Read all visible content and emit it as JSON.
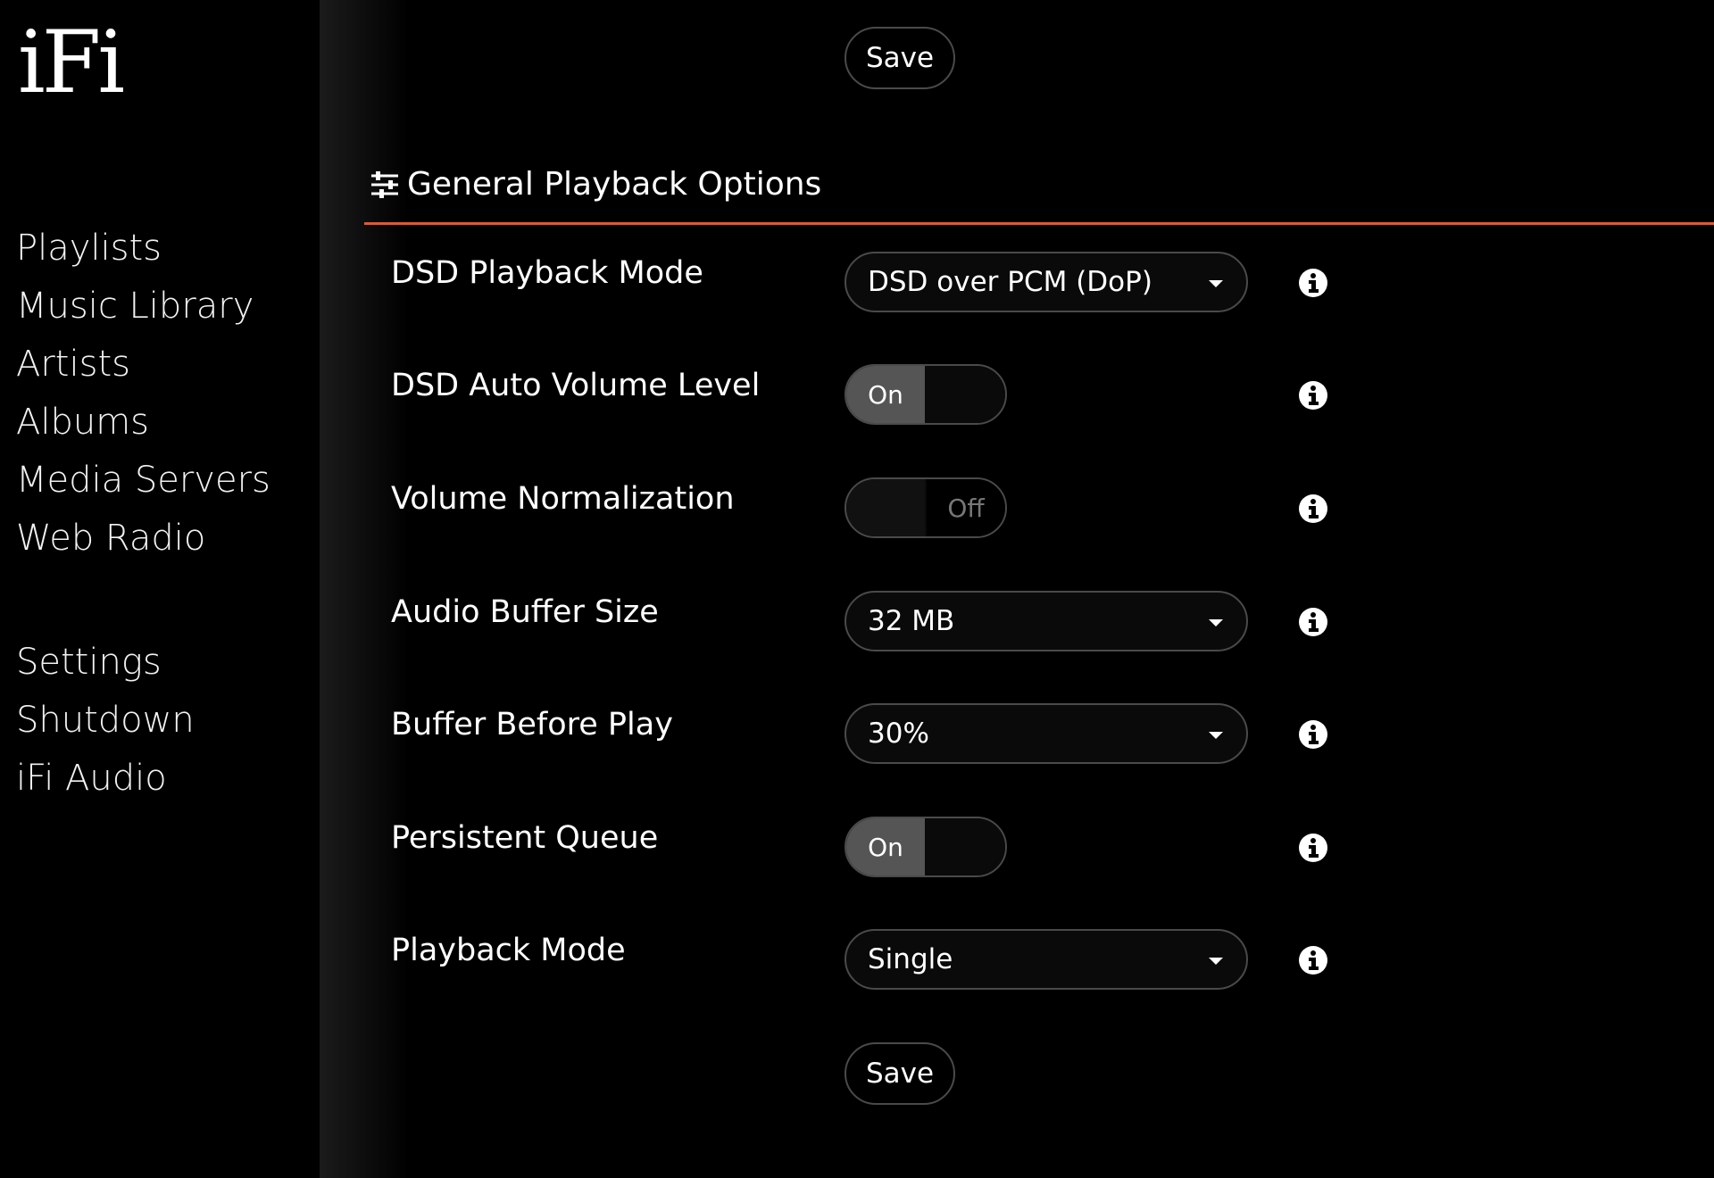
{
  "sidebar": {
    "logo_text": "iFi",
    "primary_items": [
      {
        "label": "Playlists"
      },
      {
        "label": "Music Library"
      },
      {
        "label": "Artists"
      },
      {
        "label": "Albums"
      },
      {
        "label": "Media Servers"
      },
      {
        "label": "Web Radio"
      }
    ],
    "secondary_items": [
      {
        "label": "Settings"
      },
      {
        "label": "Shutdown"
      },
      {
        "label": "iFi Audio"
      }
    ]
  },
  "main": {
    "save_label_top": "Save",
    "save_label_bottom": "Save",
    "section_title": "General Playback Options",
    "accent_color": "#e8562c",
    "rows": [
      {
        "label": "DSD Playback Mode",
        "control": "select",
        "value": "DSD over PCM (DoP)"
      },
      {
        "label": "DSD Auto Volume Level",
        "control": "toggle",
        "state": "on",
        "value": "On"
      },
      {
        "label": "Volume Normalization",
        "control": "toggle",
        "state": "off",
        "value": "Off"
      },
      {
        "label": "Audio Buffer Size",
        "control": "select",
        "value": "32 MB"
      },
      {
        "label": "Buffer Before Play",
        "control": "select",
        "value": "30%"
      },
      {
        "label": "Persistent Queue",
        "control": "toggle",
        "state": "on",
        "value": "On"
      },
      {
        "label": "Playback Mode",
        "control": "select",
        "value": "Single"
      }
    ]
  },
  "icons": {
    "section_icon": "sliders-icon",
    "info_icon": "info-circle-icon",
    "dropdown_icon": "caret-down-icon"
  }
}
